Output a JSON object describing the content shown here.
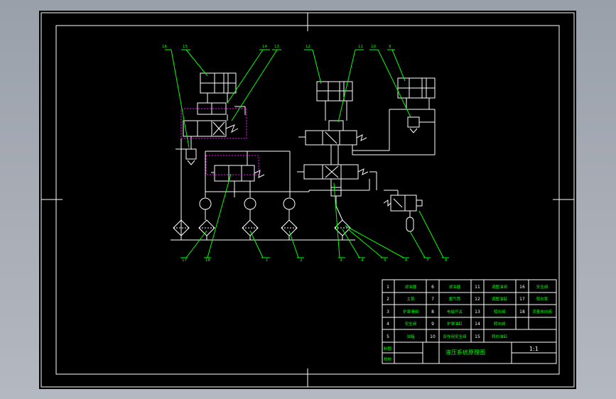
{
  "diagram": {
    "title": "液压系统原理图",
    "scale": "1:1",
    "labels": {
      "designed_by": "制图",
      "checked_by": "校核"
    },
    "parts_list": [
      {
        "no": "1",
        "name": "滤油器"
      },
      {
        "no": "2",
        "name": "主泵"
      },
      {
        "no": "3",
        "name": "护罩滑阀"
      },
      {
        "no": "4",
        "name": "安全阀"
      },
      {
        "no": "5",
        "name": "油箱"
      },
      {
        "no": "6",
        "name": "滤油器"
      },
      {
        "no": "7",
        "name": "蓄气筒"
      },
      {
        "no": "8",
        "name": "电磁开关"
      },
      {
        "no": "9",
        "name": "护罩油缸"
      },
      {
        "no": "10",
        "name": "双作用安全阀"
      },
      {
        "no": "11",
        "name": "调整油阀"
      },
      {
        "no": "12",
        "name": "调整油缸"
      },
      {
        "no": "13",
        "name": "转向阀"
      },
      {
        "no": "14",
        "name": "转向阀"
      },
      {
        "no": "15",
        "name": "转向油缸"
      },
      {
        "no": "16",
        "name": "安全阀"
      },
      {
        "no": "17",
        "name": "转向泵"
      },
      {
        "no": "18",
        "name": "流量放向阀"
      }
    ],
    "callouts_top": [
      "16",
      "15",
      "14",
      "13",
      "12",
      "11",
      "10",
      "9"
    ],
    "callouts_bottom": [
      "17",
      "18",
      "1",
      "2",
      "3",
      "4",
      "5",
      "6",
      "7",
      "8"
    ],
    "colors": {
      "background": "#000000",
      "frame": "#ffffff",
      "leaders": "#00ff00",
      "control_lines": "#ff00ff"
    }
  }
}
